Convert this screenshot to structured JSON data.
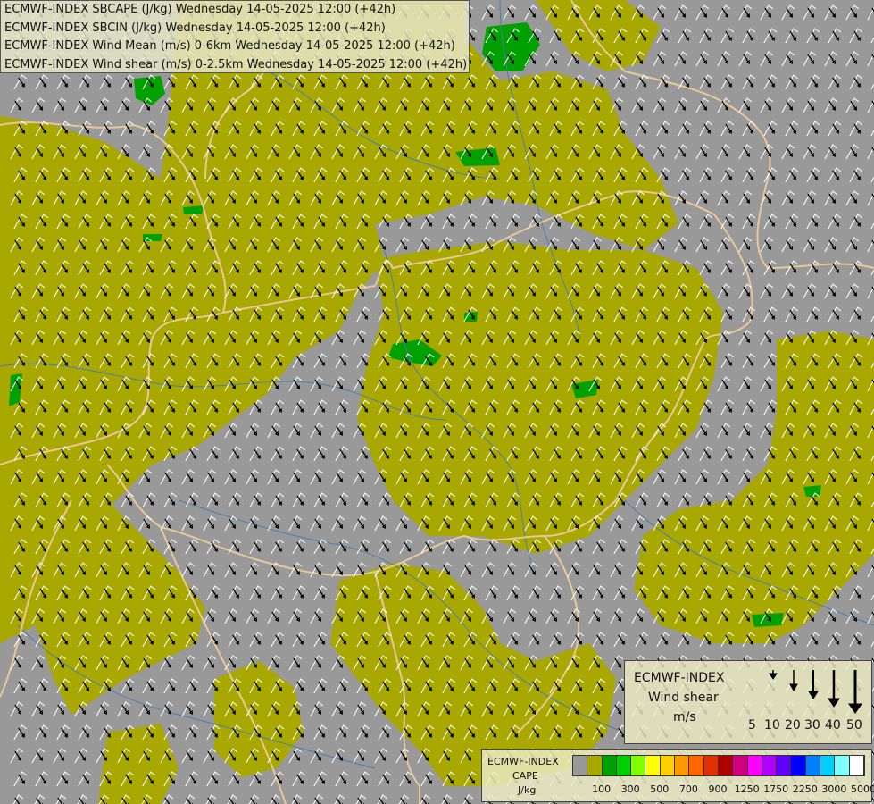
{
  "titles": [
    "ECMWF-INDEX SBCAPE (J/kg) Wednesday 14-05-2025 12:00 (+42h)",
    "ECMWF-INDEX SBCIN (J/kg) Wednesday 14-05-2025 12:00 (+42h)",
    "ECMWF-INDEX Wind Mean (m/s) 0-6km Wednesday 14-05-2025 12:00 (+42h)",
    "ECMWF-INDEX Wind shear (m/s) 0-2.5km Wednesday 14-05-2025 12:00 (+42h)"
  ],
  "shear_legend": {
    "model": "ECMWF-INDEX",
    "name": "Wind shear",
    "unit": "m/s",
    "ticks": [
      "5",
      "10",
      "20",
      "30",
      "40",
      "50"
    ]
  },
  "cape_legend": {
    "model": "ECMWF-INDEX",
    "name": "CAPE",
    "unit": "J/kg",
    "colors": [
      "#999999",
      "#a8a800",
      "#00a000",
      "#00d000",
      "#80ff00",
      "#ffff00",
      "#ffd000",
      "#ff9900",
      "#ff6600",
      "#e03000",
      "#b00000",
      "#d00080",
      "#ff00ff",
      "#b000ff",
      "#6000ff",
      "#0000ff",
      "#0080ff",
      "#00d0ff",
      "#80ffff",
      "#ffffff"
    ],
    "labels": [
      "100",
      "300",
      "500",
      "700",
      "900",
      "1250",
      "1750",
      "2250",
      "3000",
      "5000"
    ]
  },
  "map_colors": {
    "background": "#999999",
    "cape_low": "#a8a800",
    "cape_mid": "#00a000",
    "borders": "#e8c898",
    "rivers": "#4a7fb0",
    "shear_arrows": "#000000",
    "mean_wind_barbs": "#ffffff"
  }
}
